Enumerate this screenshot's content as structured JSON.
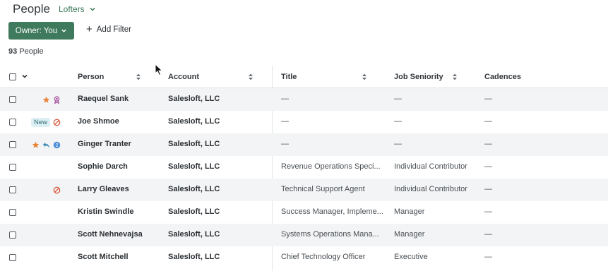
{
  "header": {
    "title": "People",
    "list_name": "Lofters"
  },
  "toolbar": {
    "owner_filter": "Owner: You",
    "add_filter": "Add Filter"
  },
  "summary": {
    "count": "93",
    "count_label": "People"
  },
  "table": {
    "columns": {
      "person": "Person",
      "account": "Account",
      "title": "Title",
      "seniority": "Job Seniority",
      "cadences": "Cadences"
    },
    "rows": [
      {
        "person": "Raequel Sank",
        "account": "Salesloft, LLC",
        "title": "—",
        "seniority": "—",
        "cadences": "—",
        "icons": [
          "star-icon",
          "award-icon"
        ]
      },
      {
        "person": "Joe Shmoe",
        "account": "Salesloft, LLC",
        "title": "—",
        "seniority": "—",
        "cadences": "—",
        "badge": "New",
        "icons": [
          "do-not-contact-icon"
        ]
      },
      {
        "person": "Ginger Tranter",
        "account": "Salesloft, LLC",
        "title": "—",
        "seniority": "—",
        "cadences": "—",
        "icons": [
          "star-icon",
          "reply-icon",
          "number-badge-icon"
        ],
        "number_badge": "2"
      },
      {
        "person": "Sophie Darch",
        "account": "Salesloft, LLC",
        "title": "Revenue Operations Speci...",
        "seniority": "Individual Contributor",
        "cadences": "—"
      },
      {
        "person": "Larry Gleaves",
        "account": "Salesloft, LLC",
        "title": "Technical Support Agent",
        "seniority": "Individual Contributor",
        "cadences": "—",
        "icons": [
          "do-not-contact-icon"
        ]
      },
      {
        "person": "Kristin Swindle",
        "account": "Salesloft, LLC",
        "title": "Success Manager, Impleme...",
        "seniority": "Manager",
        "cadences": "—"
      },
      {
        "person": "Scott Nehnevajsa",
        "account": "Salesloft, LLC",
        "title": "Systems Operations Mana...",
        "seniority": "Manager",
        "cadences": "—"
      },
      {
        "person": "Scott Mitchell",
        "account": "Salesloft, LLC",
        "title": "Chief Technology Officer",
        "seniority": "Executive",
        "cadences": "—"
      }
    ]
  },
  "colors": {
    "accent": "#3f7a5c",
    "star": "#e8853a",
    "warning": "#d9553b",
    "reply": "#3d8fb8",
    "award": "#a0479a",
    "badge_blue": "#4f8fd9"
  }
}
